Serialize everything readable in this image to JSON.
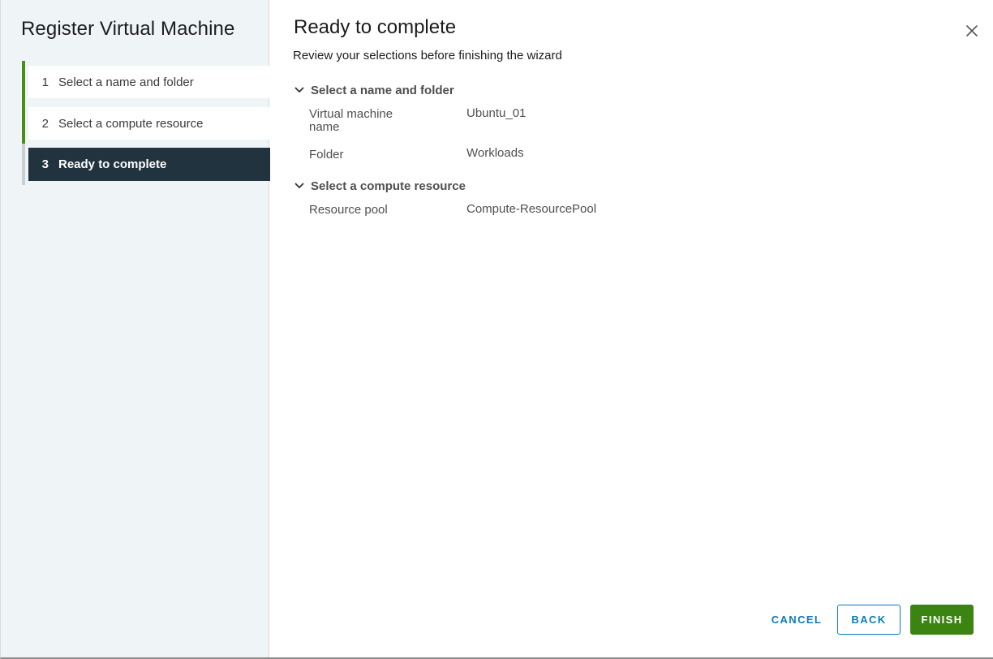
{
  "wizard": {
    "title": "Register Virtual Machine",
    "steps": [
      {
        "number": "1",
        "label": "Select a name and folder",
        "state": "done"
      },
      {
        "number": "2",
        "label": "Select a compute resource",
        "state": "done"
      },
      {
        "number": "3",
        "label": "Ready to complete",
        "state": "active"
      }
    ]
  },
  "main": {
    "title": "Ready to complete",
    "subtitle": "Review your selections before finishing the wizard",
    "sections": [
      {
        "header": "Select a name and folder",
        "rows": [
          {
            "key": "Virtual machine name",
            "value": "Ubuntu_01"
          },
          {
            "key": "Folder",
            "value": "Workloads"
          }
        ]
      },
      {
        "header": "Select a compute resource",
        "rows": [
          {
            "key": "Resource pool",
            "value": "Compute-ResourcePool"
          }
        ]
      }
    ]
  },
  "footer": {
    "cancel_label": "CANCEL",
    "back_label": "BACK",
    "finish_label": "FINISH"
  },
  "icons": {
    "close": "close-icon",
    "chevron": "chevron-down-icon"
  },
  "colors": {
    "accent_green": "#3c8412",
    "step_done_bar": "#4a8e15",
    "active_step_bg": "#21333e",
    "link_blue": "#0a7cb8",
    "sidebar_bg": "#eff4f7"
  }
}
